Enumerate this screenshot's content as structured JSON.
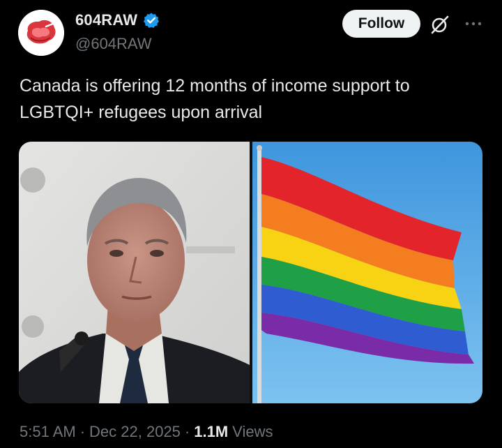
{
  "author": {
    "display_name": "604RAW",
    "handle": "@604RAW",
    "verified": true,
    "avatar_icon": "raw-steak-logo",
    "verified_color": "#1d9bf0"
  },
  "actions": {
    "follow_label": "Follow",
    "grok_icon": "grok-icon",
    "more_icon": "more-icon"
  },
  "post": {
    "text": "Canada is offering 12 months of income support to LGBTQI+ refugees upon arrival"
  },
  "media": {
    "left_image": "man-in-suit-portrait",
    "right_image": "rainbow-pride-flag"
  },
  "meta": {
    "time": "5:51 AM",
    "date": "Dec 22, 2025",
    "views_count": "1.1M",
    "views_label": "Views",
    "separator": "·"
  }
}
